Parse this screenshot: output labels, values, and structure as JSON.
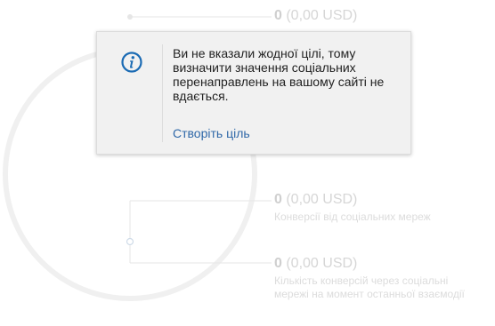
{
  "metrics": [
    {
      "value_bold": "0",
      "value_rest": " (0,00 USD)",
      "label": ""
    },
    {
      "value_bold": "0",
      "value_rest": " (0,00 USD)",
      "label": "Конверсії від соціальних мереж"
    },
    {
      "value_bold": "0",
      "value_rest": " (0,00 USD)",
      "label": "Кількість конверсій через соціальні мережі на момент останньої взаємодії"
    }
  ],
  "popup": {
    "icon": "info-icon",
    "message": "Ви не вказали жодної цілі, тому визначити значення соціальних перенаправлень на вашому сайті не вдається.",
    "link_label": "Створіть ціль"
  },
  "colors": {
    "accent": "#1b6bb4",
    "link": "#2f68a8",
    "faded_text": "#d6d6d6",
    "popup_bg": "#f1f1f1"
  }
}
